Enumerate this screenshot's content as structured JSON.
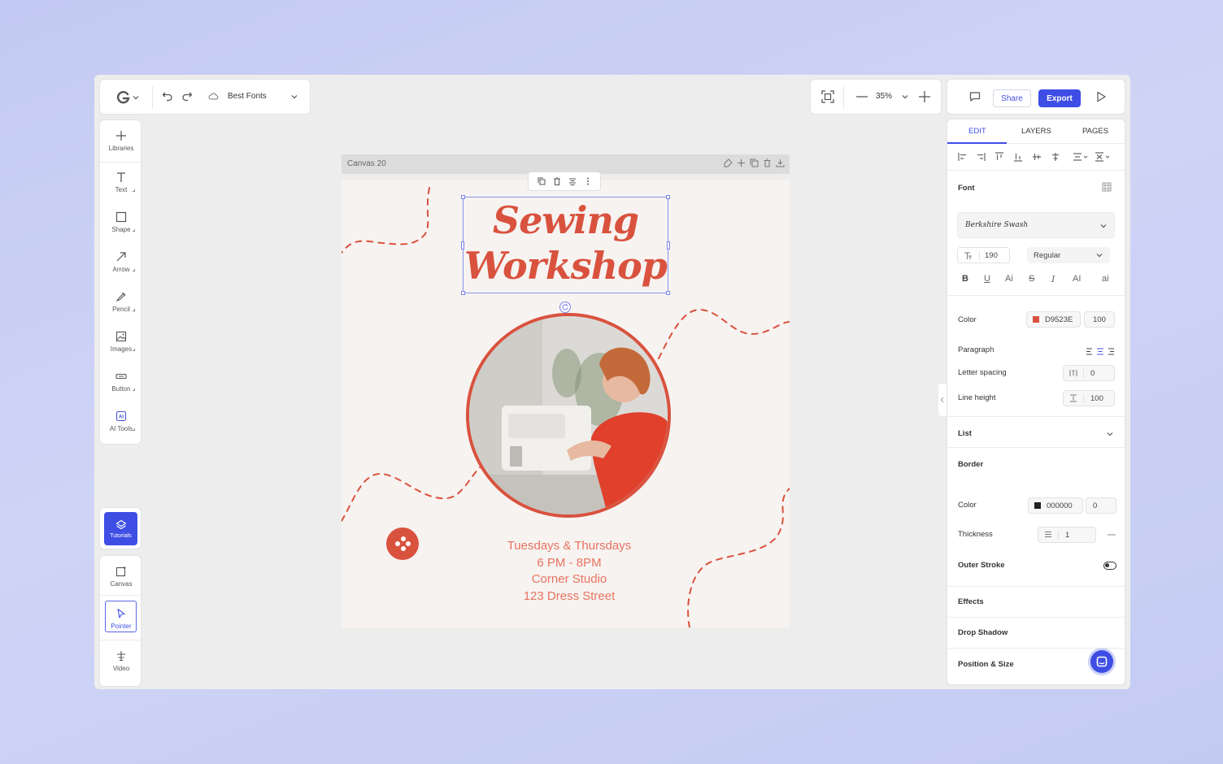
{
  "header": {
    "project_name": "Best Fonts",
    "zoom": "35%",
    "share_label": "Share",
    "export_label": "Export"
  },
  "tools": {
    "libraries": "Libraries",
    "text": "Text",
    "shape": "Shape",
    "arrow": "Arrow",
    "pencil": "Pencil",
    "images": "Images",
    "button": "Button",
    "ai_tools": "AI Tools",
    "tutorials": "Tutorials",
    "canvas": "Canvas",
    "pointer": "Pointer",
    "video": "Video"
  },
  "canvas": {
    "label": "Canvas 20",
    "title_line1": "Sewing",
    "title_line2": "Workshop",
    "event_lines": [
      "Tuesdays & Thursdays",
      "6 PM - 8PM",
      "Corner Studio",
      "123 Dress Street"
    ]
  },
  "panel": {
    "tabs": [
      "EDIT",
      "LAYERS",
      "PAGES"
    ],
    "font_label": "Font",
    "font_family": "Berkshire Swash",
    "font_size": "190",
    "font_weight": "Regular",
    "styles": [
      "B",
      "U",
      "Ai",
      "S",
      "I",
      "AI",
      "ai"
    ],
    "color_label": "Color",
    "color_hex": "D9523E",
    "color_opacity": "100",
    "paragraph_label": "Paragraph",
    "letter_spacing_label": "Letter spacing",
    "letter_spacing": "0",
    "line_height_label": "Line height",
    "line_height": "100",
    "list_label": "List",
    "border_label": "Border",
    "border_color_label": "Color",
    "border_color_hex": "000000",
    "border_color_opacity": "0",
    "thickness_label": "Thickness",
    "thickness": "1",
    "outer_stroke_label": "Outer Stroke",
    "effects_label": "Effects",
    "drop_shadow_label": "Drop Shadow",
    "position_size_label": "Position & Size"
  },
  "colors": {
    "accent": "#3E4EE5",
    "brand_red": "#D9523E",
    "text_orange": "#E8735F"
  }
}
